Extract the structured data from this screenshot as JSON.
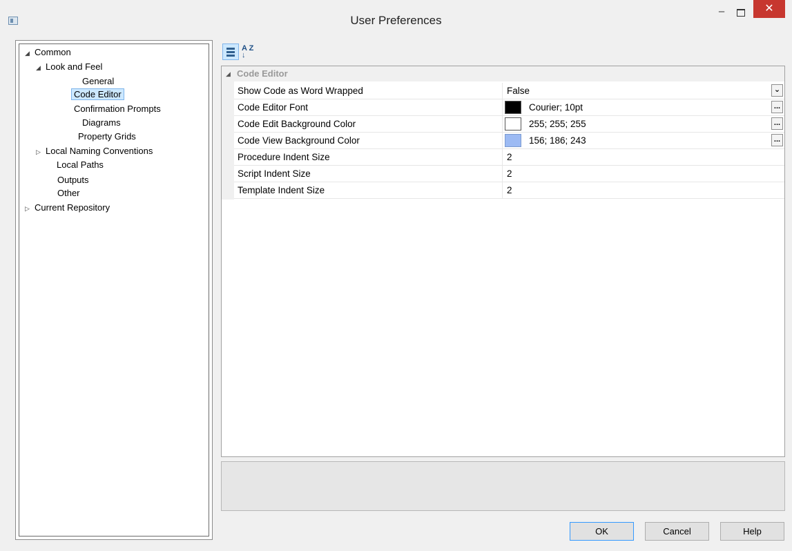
{
  "window": {
    "title": "User Preferences",
    "minimize": "–",
    "close": "✕"
  },
  "tree": {
    "nodes": [
      {
        "label": "Common",
        "expander": "◢"
      },
      {
        "label": "Look and Feel",
        "expander": "◢"
      },
      {
        "label": "General"
      },
      {
        "label": "Code Editor",
        "selected": true
      },
      {
        "label": "Confirmation Prompts"
      },
      {
        "label": "Diagrams"
      },
      {
        "label": "Property Grids"
      },
      {
        "label": "Local Naming Conventions",
        "expander": "▷"
      },
      {
        "label": "Local Paths"
      },
      {
        "label": "Outputs"
      },
      {
        "label": "Other"
      },
      {
        "label": "Current Repository",
        "expander": "▷"
      }
    ]
  },
  "toolbar": {
    "alpha_icon": "A Z ↓"
  },
  "grid": {
    "category": {
      "label": "Code Editor",
      "expander": "◢"
    },
    "rows": [
      {
        "name": "Show Code as Word Wrapped",
        "value": "False",
        "button": "⌄"
      },
      {
        "name": "Code Editor Font",
        "value": "Courier; 10pt",
        "swatch": "#000000",
        "button": "..."
      },
      {
        "name": "Code Edit Background Color",
        "value": "255; 255; 255",
        "swatch": "#ffffff",
        "button": "..."
      },
      {
        "name": "Code View Background Color",
        "value": "156; 186; 243",
        "swatch": "#9cbaf3",
        "button": "..."
      },
      {
        "name": "Procedure Indent Size",
        "value": "2"
      },
      {
        "name": "Script Indent Size",
        "value": "2"
      },
      {
        "name": "Template Indent Size",
        "value": "2"
      }
    ]
  },
  "buttons": {
    "ok": "OK",
    "cancel": "Cancel",
    "help": "Help"
  }
}
